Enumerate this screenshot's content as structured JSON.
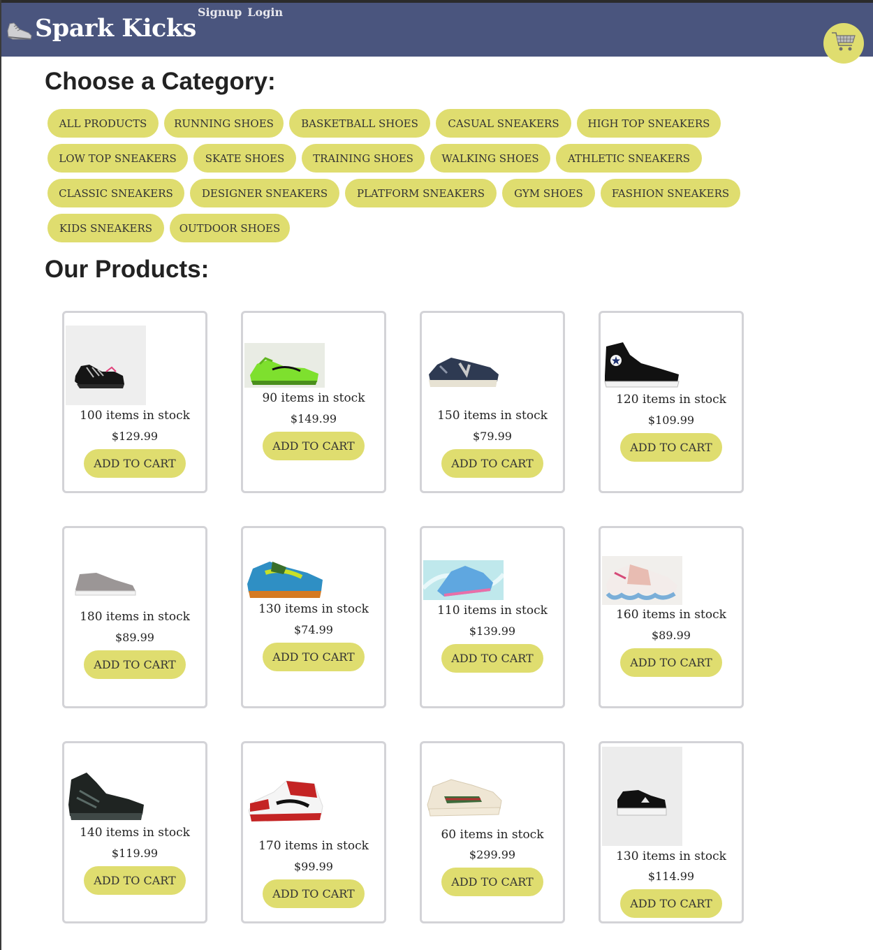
{
  "header": {
    "brand": "Spark Kicks",
    "signup_label": "Signup",
    "login_label": "Login",
    "cart_icon": "cart-icon",
    "brand_icon": "sneaker-icon",
    "bg_color": "#4a557e",
    "accent_color": "#dfdd6f"
  },
  "categories": {
    "title": "Choose a Category:",
    "items": [
      "All Products",
      "Running Shoes",
      "Basketball Shoes",
      "Casual Sneakers",
      "High Top Sneakers",
      "Low Top Sneakers",
      "Skate Shoes",
      "Training Shoes",
      "Walking Shoes",
      "Athletic Sneakers",
      "Classic Sneakers",
      "Designer Sneakers",
      "Platform Sneakers",
      "Gym Shoes",
      "Fashion Sneakers",
      "Kids Sneakers",
      "Outdoor Shoes"
    ]
  },
  "products": {
    "title": "Our Products:",
    "add_label": "ADD TO CART",
    "items": [
      {
        "stock": "100 items in stock",
        "price": "$129.99",
        "image": "black-running-shoe"
      },
      {
        "stock": "90 items in stock",
        "price": "$149.99",
        "image": "green-basketball-shoe"
      },
      {
        "stock": "150 items in stock",
        "price": "$79.99",
        "image": "navy-suede-sneaker"
      },
      {
        "stock": "120 items in stock",
        "price": "$109.99",
        "image": "black-high-top-canvas"
      },
      {
        "stock": "180 items in stock",
        "price": "$89.99",
        "image": "grey-low-top-sneaker"
      },
      {
        "stock": "130 items in stock",
        "price": "$74.99",
        "image": "multicolor-skate-shoe"
      },
      {
        "stock": "110 items in stock",
        "price": "$139.99",
        "image": "blue-running-shoe"
      },
      {
        "stock": "160 items in stock",
        "price": "$89.99",
        "image": "white-pink-running-shoe"
      },
      {
        "stock": "140 items in stock",
        "price": "$119.99",
        "image": "black-hiking-boot"
      },
      {
        "stock": "170 items in stock",
        "price": "$99.99",
        "image": "red-high-top-sneaker"
      },
      {
        "stock": "60 items in stock",
        "price": "$299.99",
        "image": "cream-designer-sneaker"
      },
      {
        "stock": "130 items in stock",
        "price": "$114.99",
        "image": "black-platform-sneaker"
      }
    ]
  }
}
